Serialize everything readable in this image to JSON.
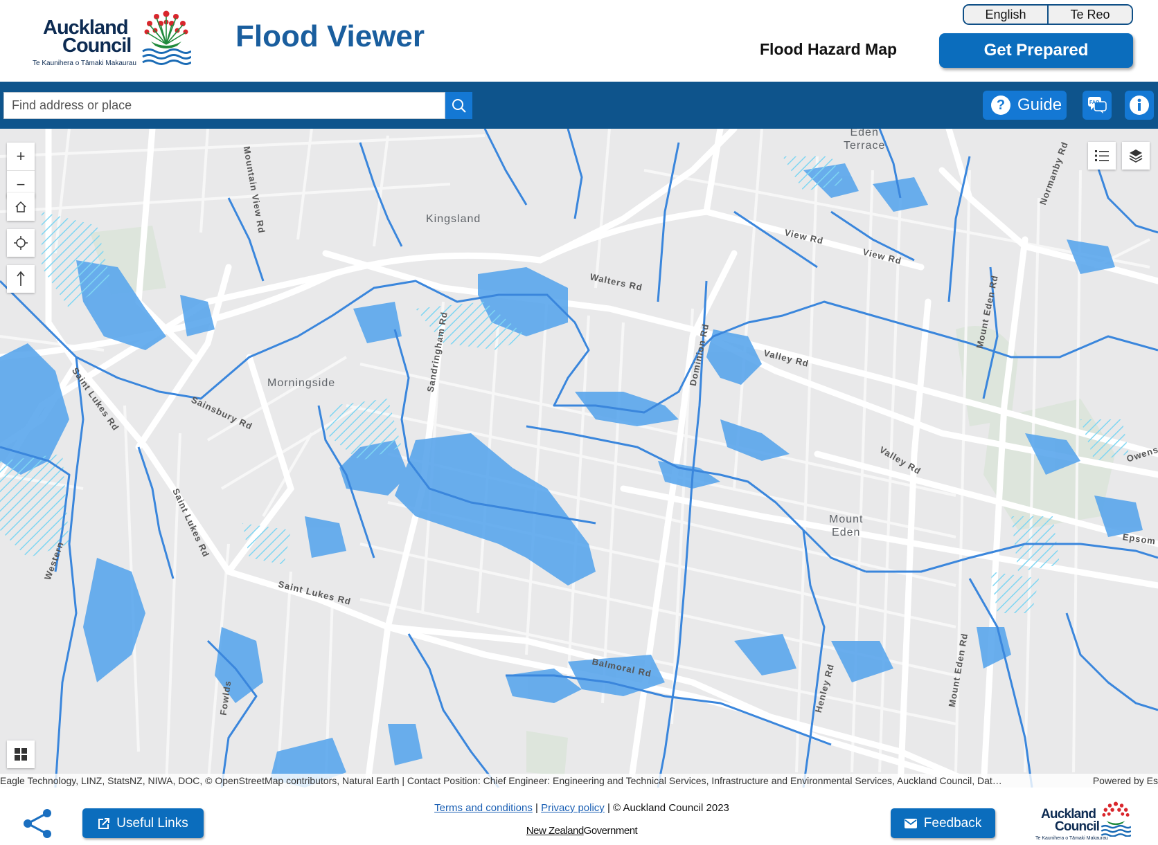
{
  "header": {
    "logo_line1": "Auckland",
    "logo_line2": "Council",
    "logo_tagline": "Te Kaunihera o Tāmaki Makaurau",
    "app_title": "Flood Viewer",
    "map_title": "Flood Hazard Map",
    "languages": [
      "English",
      "Te Reo"
    ],
    "get_prepared_label": "Get Prepared"
  },
  "toolbar": {
    "search_placeholder": "Find address or place",
    "guide_label": "Guide",
    "faq_icon": "faq-icon",
    "info_icon": "info-icon"
  },
  "map": {
    "places": [
      {
        "name": "Kingsland"
      },
      {
        "name": "Eden\nTerrace"
      },
      {
        "name": "Morningside"
      },
      {
        "name": "Mount\nEden"
      }
    ],
    "roads": [
      "Mountain View Rd",
      "View Rd",
      "View Rd",
      "Walters Rd",
      "Dominion Rd",
      "Valley Rd",
      "Valley Rd",
      "Sandringham Rd",
      "Saint Lukes Rd",
      "Sainsbury Rd",
      "Saint Lukes Rd",
      "Saint Lukes Rd",
      "Mount Eden Rd",
      "Normanby Rd",
      "Owens",
      "Epsom",
      "Balmoral Rd",
      "Henley Rd",
      "Mount Eden Rd",
      "Fowlds",
      "Western"
    ],
    "zoom_in": "+",
    "zoom_out": "−",
    "colors": {
      "flood_fill": "#5aa6ec",
      "flow_path": "#3a86dc",
      "hatch": "#7fd6f2",
      "map_bg": "#e9e9ea",
      "road": "#ffffff"
    },
    "attribution": "Eagle Technology, LINZ, StatsNZ, NIWA, DOC, © OpenStreetMap contributors, Natural Earth | Contact Position: Chief Engineer: Engineering and Technical Services, Infrastructure and Environmental Services, Auckland Council, Dat…",
    "powered_by": "Powered by Es"
  },
  "footer": {
    "useful_links_label": "Useful Links",
    "terms_label": "Terms and conditions",
    "separator": "|",
    "privacy_label": "Privacy policy",
    "copyright": "| © Auckland Council 2023",
    "nzgov_part1": "New Zealand",
    "nzgov_part2": "Government",
    "feedback_label": "Feedback",
    "logo_line1": "Auckland",
    "logo_line2": "Council",
    "logo_tagline": "Te Kaunihera o Tāmaki Makaurau"
  },
  "brand": {
    "primary_blue": "#0b6dbd",
    "toolbar_blue": "#0e548c",
    "title_blue": "#1a5e9e",
    "logo_red": "#d9262c"
  }
}
